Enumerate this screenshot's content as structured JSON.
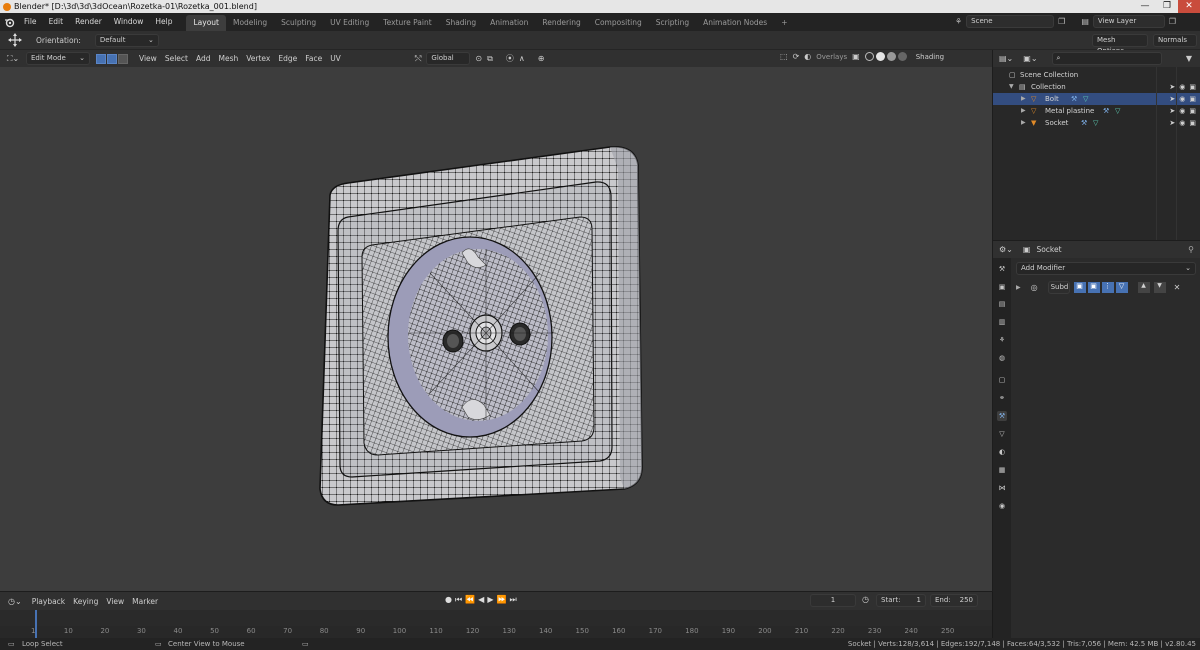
{
  "window": {
    "title": "Blender* [D:\\3d\\3d\\3dOcean\\Rozetka-01\\Rozetka_001.blend]",
    "controls": [
      "—",
      "❐",
      "✕"
    ]
  },
  "menu": [
    "File",
    "Edit",
    "Render",
    "Window",
    "Help"
  ],
  "workspaces": [
    "Layout",
    "Modeling",
    "Sculpting",
    "UV Editing",
    "Texture Paint",
    "Shading",
    "Animation",
    "Rendering",
    "Compositing",
    "Scripting",
    "Animation Nodes"
  ],
  "workspace_add": "+",
  "scene": {
    "label": "Scene",
    "view_layer": "View Layer"
  },
  "toolheader": {
    "orientation_label": "Orientation:",
    "orientation_value": "Default",
    "mesh_options": "Mesh Options",
    "normals": "Normals"
  },
  "viewheader": {
    "mode": "Edit Mode",
    "menus": [
      "View",
      "Select",
      "Add",
      "Mesh",
      "Vertex",
      "Edge",
      "Face",
      "UV"
    ],
    "transform": "Global",
    "overlays": "Overlays",
    "shading": "Shading"
  },
  "outliner": {
    "search_placeholder": "",
    "rows": [
      {
        "label": "Scene Collection",
        "indent": 0,
        "selected": false
      },
      {
        "label": "Collection",
        "indent": 1,
        "selected": false
      },
      {
        "label": "Bolt",
        "indent": 2,
        "selected": true
      },
      {
        "label": "Metal plastine",
        "indent": 2,
        "selected": false
      },
      {
        "label": "Socket",
        "indent": 2,
        "selected": false
      }
    ]
  },
  "properties": {
    "object_name": "Socket",
    "add_modifier": "Add Modifier",
    "modifier_name": "Subd"
  },
  "timeline": {
    "menus": [
      "Playback",
      "Keying",
      "View",
      "Marker"
    ],
    "current_frame": "1",
    "start_label": "Start:",
    "start": "1",
    "end_label": "End:",
    "end": "250",
    "ticks": [
      "1",
      "10",
      "20",
      "30",
      "40",
      "50",
      "60",
      "70",
      "80",
      "90",
      "100",
      "110",
      "120",
      "130",
      "140",
      "150",
      "160",
      "170",
      "180",
      "190",
      "200",
      "210",
      "220",
      "230",
      "240",
      "250"
    ],
    "playhead_frame": 1
  },
  "status": {
    "left_action": "Loop Select",
    "mid_action": "Center View to Mouse",
    "stats": "Socket | Verts:128/3,614 | Edges:192/7,148 | Faces:64/3,532 | Tris:7,056 | Mem: 42.5 MB | v2.80.45"
  },
  "colors": {
    "accent_blue": "#4772b3",
    "selection_row": "#334d80",
    "viewport_bg": "#3d3d3d",
    "mesh_face": "#c9c9cc",
    "mesh_wire": "#111111",
    "orange_object": "#e08a28"
  }
}
